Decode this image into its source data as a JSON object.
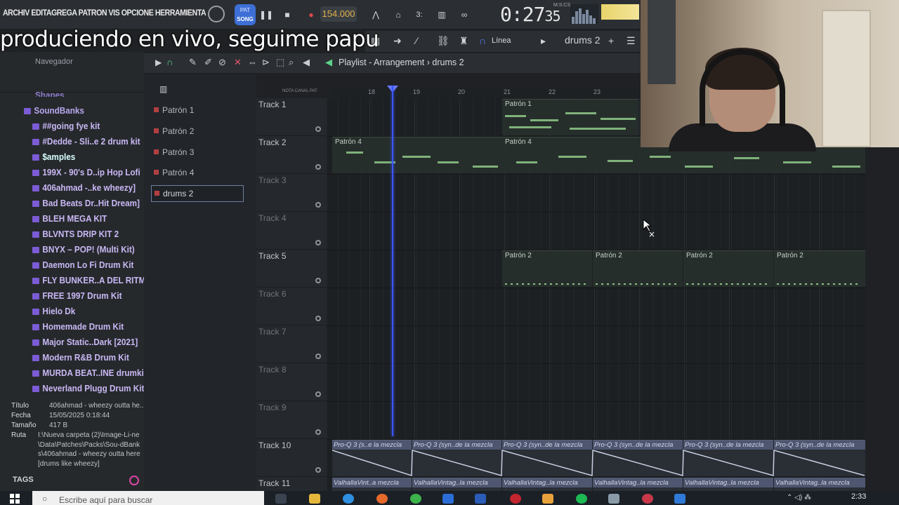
{
  "menu": {
    "text": "ARCHIV EDITAGREGA PATRON VIS OPCIONE HERRAMIENTA"
  },
  "transport": {
    "pat_label": "PAT",
    "song_label": "SONG",
    "tempo": "154.000",
    "time": "0:27",
    "time_sub": "35",
    "mcs_label": "M:S:CS"
  },
  "caption": "produciendo en vivo, seguime papu",
  "toolbar2": {
    "mode": "Línea",
    "selected_pattern": "drums 2"
  },
  "browser": {
    "header": "Navegador",
    "items": [
      "Shapes",
      "SoundBanks",
      "##going fye kit",
      "#Dedde - Sli..e 2 drum kit",
      "$amples",
      "199X - 90's D..ip Hop Lofi",
      "406ahmad -..ke wheezy]",
      "Bad Beats Dr..Hit Dream]",
      "BLEH MEGA KIT",
      "BLVNTS DRIP KIT 2",
      "BNYX – POP! (Multi Kit)",
      "Daemon Lo Fi Drum Kit",
      "FLY BUNKER..A DEL RITMO",
      "FREE 1997 Drum Kit",
      "Hielo Dk",
      "Homemade Drum Kit",
      "Major Static..Dark [2021]",
      "Modern R&B Drum Kit",
      "MURDA BEAT..INE drumkit",
      "Neverland Plugg Drum Kit"
    ],
    "info": {
      "titulo_k": "Título",
      "titulo_v": "406ahmad - wheezy outta he..",
      "fecha_k": "Fecha",
      "fecha_v": "15/05/2025 0:18:44",
      "tamano_k": "Tamaño",
      "tamano_v": "417 B",
      "ruta_k": "Ruta",
      "ruta_v": "I:\\Nueva carpeta (2)\\Image-Li-ne\\Data\\Patches\\Packs\\Sou-dBanks\\406ahmad - wheezy outta here [drums like wheezy]"
    },
    "tags": "TAGS"
  },
  "patterns": [
    "Patrón 1",
    "Patrón 2",
    "Patrón 3",
    "Patrón 4",
    "drums 2"
  ],
  "playlist": {
    "title": "Playlist - Arrangement › drums 2",
    "ruler_note": "NOTA  CANAL  PAT",
    "bars": [
      "18",
      "19",
      "20",
      "21",
      "22",
      "23"
    ],
    "tracks": [
      "Track 1",
      "Track 2",
      "Track 3",
      "Track 4",
      "Track 5",
      "Track 6",
      "Track 7",
      "Track 8",
      "Track 9",
      "Track 10",
      "Track 11"
    ],
    "clip_labels": {
      "p1": "Patrón 1",
      "p4": "Patrón 4",
      "p2": "Patrón 2",
      "proq": "Pro-Q 3 (syn..de la mezcla",
      "proq_short": "Pro-Q 3 (s..e la mezcla",
      "valhalla": "ValhallaVintag..la mezcla",
      "valhalla_short": "ValhallaVint..a mezcla"
    }
  },
  "taskbar": {
    "search_placeholder": "Escribe aquí para buscar",
    "clock": "2:33"
  }
}
